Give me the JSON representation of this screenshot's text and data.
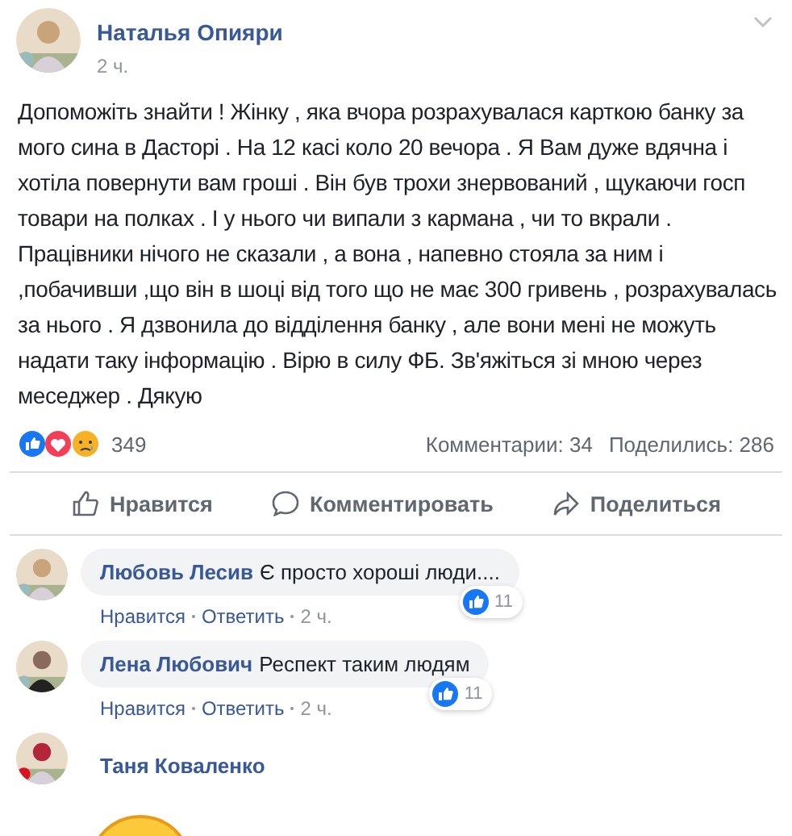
{
  "post": {
    "author": "Наталья Опияри",
    "time": "2 ч.",
    "text": "Допоможіть знайти ! Жінку , яка вчора розрахувалася карткою банку за мого сина в Дасторі . На 12 касі коло 20 вечора . Я Вам дуже вдячна і хотіла повернути вам гроші . Він був трохи знервований , щукаючи госп товари на полках . І у нього чи випали з кармана , чи то вкрали . Працівники нічого не сказали , а вона , напевно стояла за ним і ,побачивши ,що він в шоці від того що не має 300 гривень , розрахувалась за нього . Я дзвонила до відділення банку , але вони мені не можуть надати таку інформацію . Вірю в силу ФБ. Зв'яжіться зі мною через меседжер . Дякую",
    "reactions_count": "349",
    "comments_count": "Комментарии: 34",
    "shares_count": "Поделились: 286"
  },
  "actions": [
    {
      "kind": "like",
      "label": "Нравится"
    },
    {
      "kind": "comment",
      "label": "Комментировать"
    },
    {
      "kind": "share",
      "label": "Поделиться"
    }
  ],
  "comments": [
    {
      "kind": "text",
      "author": "Любовь Лесив",
      "text": "Є просто хороші люди....",
      "likes": "11",
      "like": "Нравится",
      "reply": "Ответить",
      "time": "2 ч."
    },
    {
      "kind": "text",
      "author": "Лена Любович",
      "text": "Респект таким людям",
      "likes": "11",
      "like": "Нравится",
      "reply": "Ответить",
      "time": "2 ч."
    },
    {
      "kind": "sticker",
      "author": "Таня Коваленко"
    }
  ]
}
